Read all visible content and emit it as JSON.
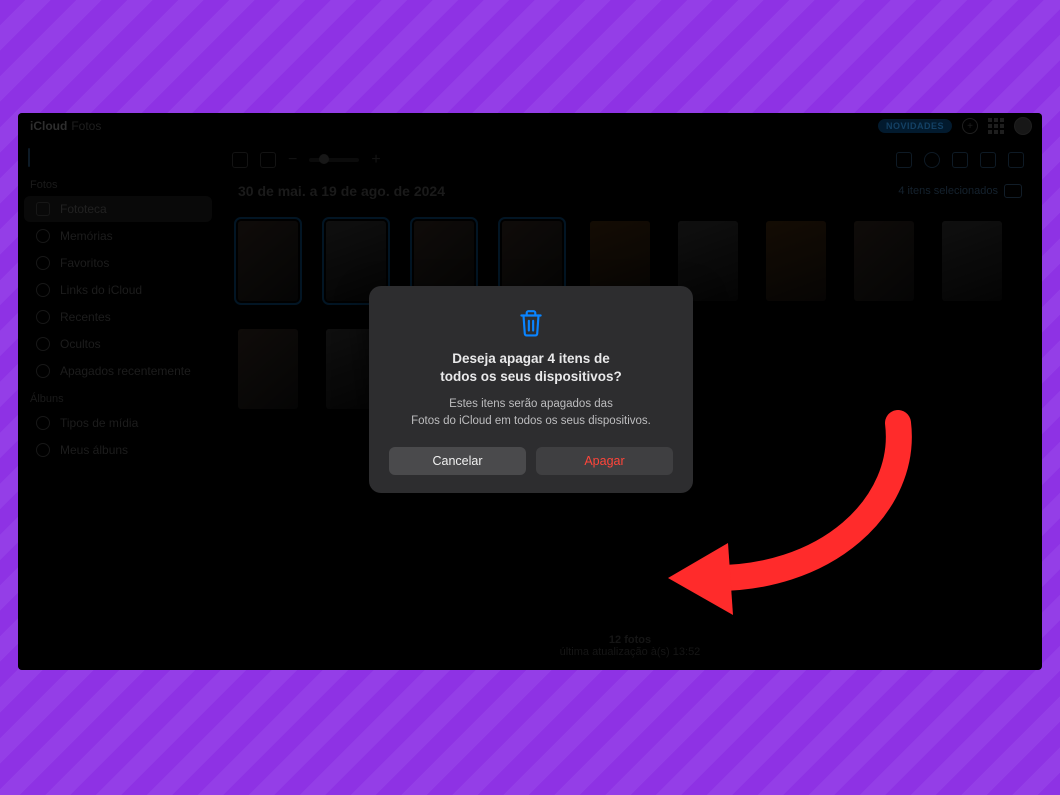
{
  "topbar": {
    "brand_strong": "iCloud",
    "brand_light": "Fotos",
    "badge": "NOVIDADES"
  },
  "sidebar": {
    "section_fotos": "Fotos",
    "section_albuns": "Álbuns",
    "items": [
      {
        "label": "Fototeca"
      },
      {
        "label": "Memórias"
      },
      {
        "label": "Favoritos"
      },
      {
        "label": "Links do iCloud"
      },
      {
        "label": "Recentes"
      },
      {
        "label": "Ocultos"
      },
      {
        "label": "Apagados recentemente"
      }
    ],
    "album_items": [
      {
        "label": "Tipos de mídia"
      },
      {
        "label": "Meus álbuns"
      }
    ]
  },
  "content": {
    "date_range": "30 de mai. a 19 de ago. de 2024",
    "selection_label": "4 itens selecionados",
    "footer_count": "12 fotos",
    "footer_updated": "última atualização à(s) 13:52"
  },
  "dialog": {
    "title_line1": "Deseja apagar 4 itens de",
    "title_line2": "todos os seus dispositivos?",
    "message_line1": "Estes itens serão apagados das",
    "message_line2": "Fotos do iCloud em todos os seus dispositivos.",
    "cancel": "Cancelar",
    "confirm": "Apagar"
  },
  "colors": {
    "accent": "#0a84ff",
    "danger": "#ff453a",
    "frame_purple": "#8f34e4"
  }
}
